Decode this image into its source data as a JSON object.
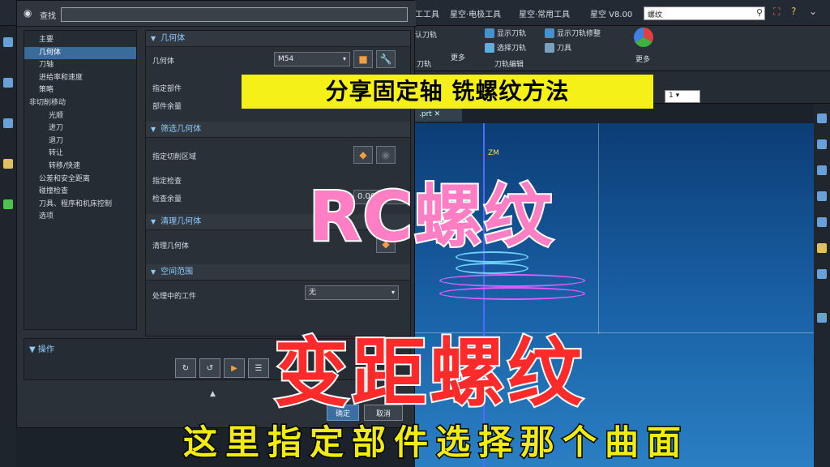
{
  "app": {
    "ribbon_tabs": [
      "工工具",
      "星空·电极工具",
      "星空·常用工具",
      "星空 V8.00"
    ],
    "search_value": "螺纹",
    "ribbon": {
      "items": [
        "认刀轨",
        "显示刀轨",
        "显示刀轨修整",
        "选择刀轨",
        "刀具",
        "更多",
        "刀轨编辑",
        "更多",
        "刀轨"
      ],
      "combo_value": "1"
    },
    "viewport_tab": ".prt",
    "axis_label": "ZM"
  },
  "dialog": {
    "find_label": "查找",
    "find_value": "",
    "tree": [
      {
        "label": "主要",
        "selected": false,
        "indent": 1
      },
      {
        "label": "几何体",
        "selected": true,
        "indent": 1
      },
      {
        "label": "刀轴",
        "selected": false,
        "indent": 1
      },
      {
        "label": "进给率和速度",
        "selected": false,
        "indent": 1
      },
      {
        "label": "策略",
        "selected": false,
        "indent": 1
      },
      {
        "label": "非切削移动",
        "selected": false,
        "indent": 0
      },
      {
        "label": "光顺",
        "selected": false,
        "indent": 2
      },
      {
        "label": "进刀",
        "selected": false,
        "indent": 2
      },
      {
        "label": "退刀",
        "selected": false,
        "indent": 2
      },
      {
        "label": "转让",
        "selected": false,
        "indent": 2
      },
      {
        "label": "转移/快速",
        "selected": false,
        "indent": 2
      },
      {
        "label": "公差和安全距离",
        "selected": false,
        "indent": 1
      },
      {
        "label": "碰撞检查",
        "selected": false,
        "indent": 1
      },
      {
        "label": "刀具、程序和机床控制",
        "selected": false,
        "indent": 1
      },
      {
        "label": "选项",
        "selected": false,
        "indent": 1
      }
    ],
    "sections": {
      "geometry": {
        "title": "几何体",
        "geometry_label": "几何体",
        "geometry_value": "M54",
        "part_label": "指定部件",
        "part_stock_label": "部件余量"
      },
      "filter": {
        "title": "筛选几何体",
        "cut_region_label": "指定切削区域",
        "check_label": "指定检查",
        "check_stock_label": "检查余量",
        "check_stock_value": "0.000"
      },
      "clean": {
        "title": "清理几何体",
        "clean_label": "清理几何体"
      },
      "space": {
        "title": "空间范围",
        "ipw_label": "处理中的工件",
        "ipw_value": "无"
      }
    },
    "operations_title": "操作",
    "buttons": {
      "ok": "确定",
      "cancel": "取消"
    }
  },
  "captions": {
    "top": "分享固定轴 铣螺纹方法",
    "rc": "RC螺纹",
    "variable": "变距螺纹",
    "bottom": "这里指定部件选择那个曲面"
  },
  "colors": {
    "caption_top_bg": "#f4f018",
    "caption_rc": "#ff7ec4",
    "caption_variable": "#ff2b2b",
    "caption_bottom": "#f0ec10",
    "selection": "#3a6c9a"
  }
}
